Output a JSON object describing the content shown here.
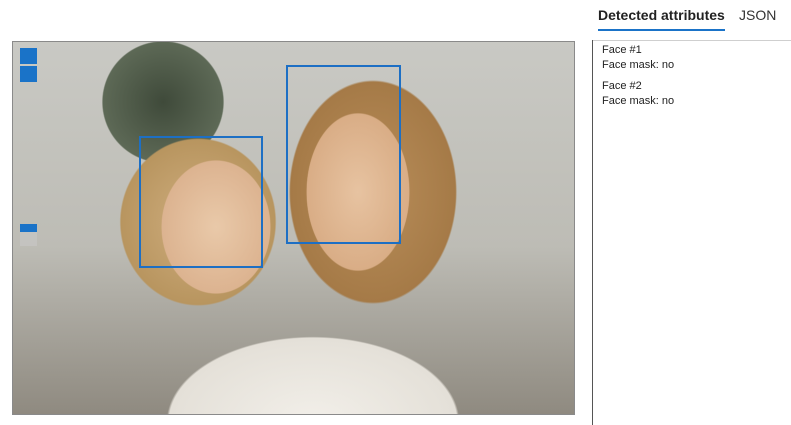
{
  "tabs": {
    "attributes_label": "Detected attributes",
    "json_label": "JSON"
  },
  "faces": [
    {
      "title": "Face #1",
      "mask_label": "Face mask: no"
    },
    {
      "title": "Face #2",
      "mask_label": "Face mask: no"
    }
  ],
  "colors": {
    "accent": "#1a73c8",
    "box": "#1d6fc4"
  }
}
